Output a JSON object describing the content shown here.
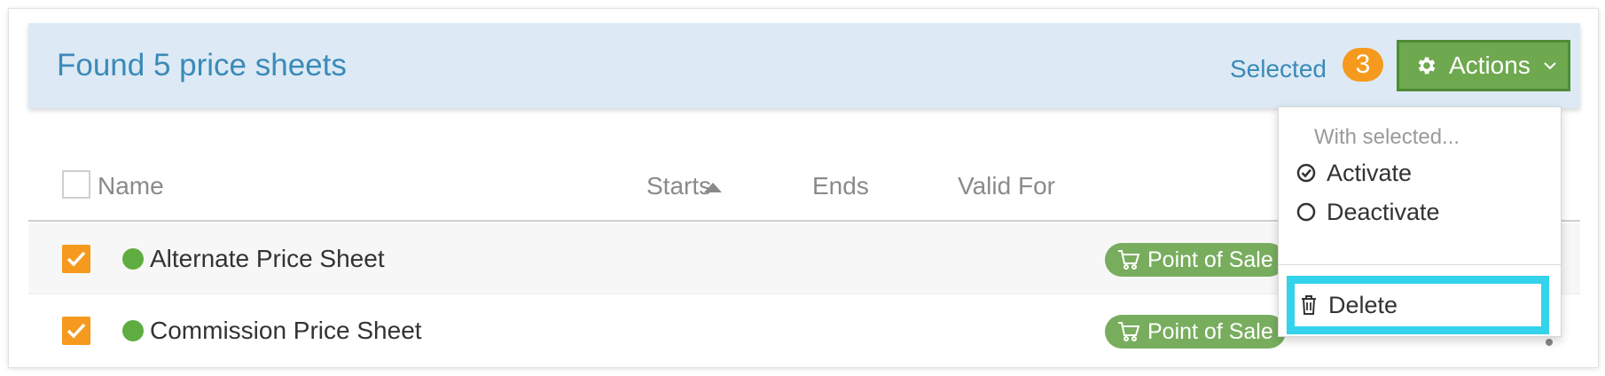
{
  "header": {
    "title": "Found 5 price sheets",
    "selected_label": "Selected",
    "selected_count": "3",
    "actions_label": "Actions"
  },
  "table": {
    "columns": [
      "Name",
      "Starts",
      "Ends",
      "Valid For"
    ],
    "rows": [
      {
        "name": "Alternate Price Sheet",
        "checked": true,
        "status": "active",
        "valid_for": "Point of Sale"
      },
      {
        "name": "Commission Price Sheet",
        "checked": true,
        "status": "active",
        "valid_for": "Point of Sale"
      }
    ]
  },
  "actions_menu": {
    "header": "With selected...",
    "items": [
      {
        "label": "Activate",
        "icon": "check-circle-icon"
      },
      {
        "label": "Deactivate",
        "icon": "circle-icon"
      },
      {
        "label": "Delete",
        "icon": "trash-icon"
      }
    ]
  },
  "colors": {
    "header_bg": "#ddeaf5",
    "header_text": "#3a8ab8",
    "count_badge": "#f59a1e",
    "actions_button": "#6ea84f",
    "status_active": "#5fad41",
    "pill": "#78ad5e",
    "checkbox_checked": "#f59a1e",
    "highlight": "#33d3ec"
  }
}
